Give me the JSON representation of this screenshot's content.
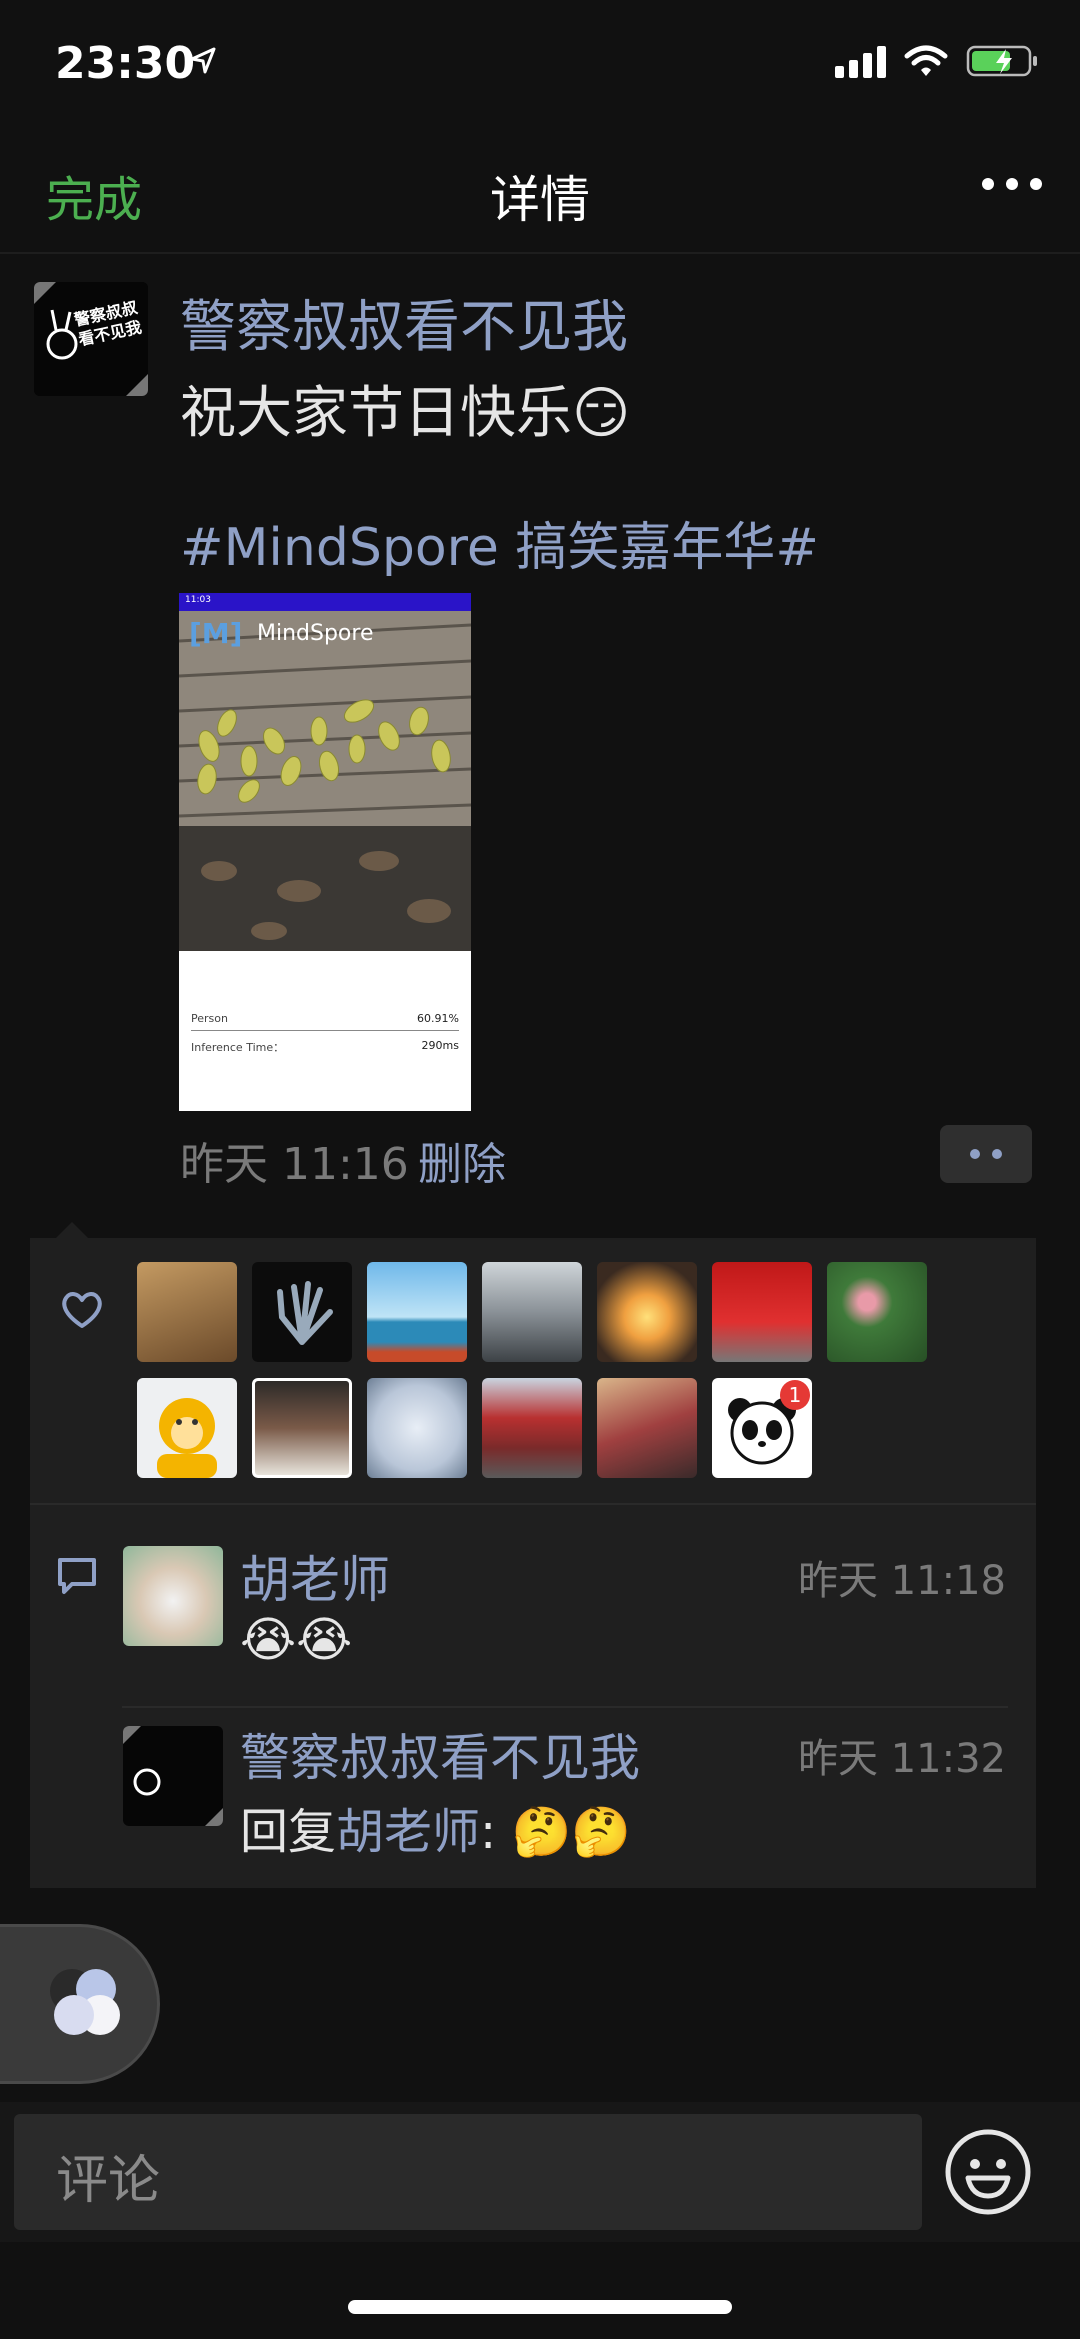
{
  "status_bar": {
    "time": "23:30",
    "location_icon": "location-arrow-icon",
    "signal_icon": "cellular-signal-icon",
    "wifi_icon": "wifi-icon",
    "battery_icon": "battery-charging-icon",
    "battery_color": "#5ad15a"
  },
  "nav": {
    "done_label": "完成",
    "title": "详情",
    "more_icon": "more-dots-icon",
    "accent_color": "#4caf50"
  },
  "post": {
    "author": "警察叔叔看不见我",
    "avatar_text": "警察叔叔看不见我",
    "text": "祝大家节日快乐😏",
    "hashtag": "#MindSpore 搞笑嘉年华#",
    "time": "昨天 11:16",
    "delete_label": "删除",
    "action_icon": "more-action-icon",
    "image": {
      "status_time": "11:03",
      "app_title": "MindSpore",
      "logo_text": "[M]",
      "result_label": "Person",
      "result_value": "60.91%",
      "inference_label": "Inference Time：",
      "inference_value": "290ms"
    }
  },
  "likes": {
    "icon": "heart-icon",
    "badge_count": "1",
    "count": 14
  },
  "comments": [
    {
      "name": "胡老师",
      "time": "昨天 11:18",
      "text": "😭😭"
    },
    {
      "name": "警察叔叔看不见我",
      "time": "昨天 11:32",
      "reply_prefix": "回复",
      "reply_to": "胡老师",
      "reply_colon": ":",
      "text": " 🤔🤔"
    }
  ],
  "comment_icon": "comment-bubble-icon",
  "floating_icon": "floating-window-icon",
  "input": {
    "placeholder": "评论",
    "emoji_icon": "emoji-smile-icon"
  }
}
